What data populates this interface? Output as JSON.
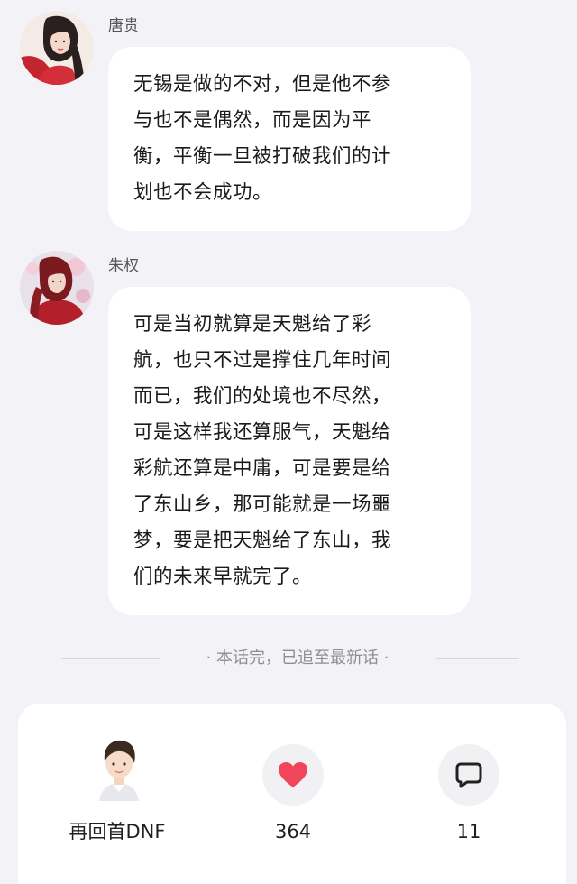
{
  "messages": [
    {
      "sender": "唐贵",
      "lines": [
        "无锡是做的不对，但是他不参",
        "与也不是偶然，而是因为平",
        "衡，平衡一旦被打破我们的计",
        "划也不会成功。"
      ]
    },
    {
      "sender": "朱权",
      "lines": [
        "可是当初就算是天魁给了彩",
        "航，也只不过是撑住几年时间",
        "而已，我们的处境也不尽然，",
        "可是这样我还算服气，天魁给",
        "彩航还算是中庸，可是要是给",
        "了东山乡，那可能就是一场噩",
        "梦，要是把天魁给了东山，我",
        "们的未来早就完了。"
      ]
    }
  ],
  "end_notice": "· 本话完，已追至最新话 ·",
  "footer": {
    "author_name": "再回首DNF",
    "like_count": "364",
    "comment_count": "11",
    "like_icon": "heart-icon",
    "comment_icon": "comment-bubble-icon",
    "accent_color": "#f0455c"
  }
}
